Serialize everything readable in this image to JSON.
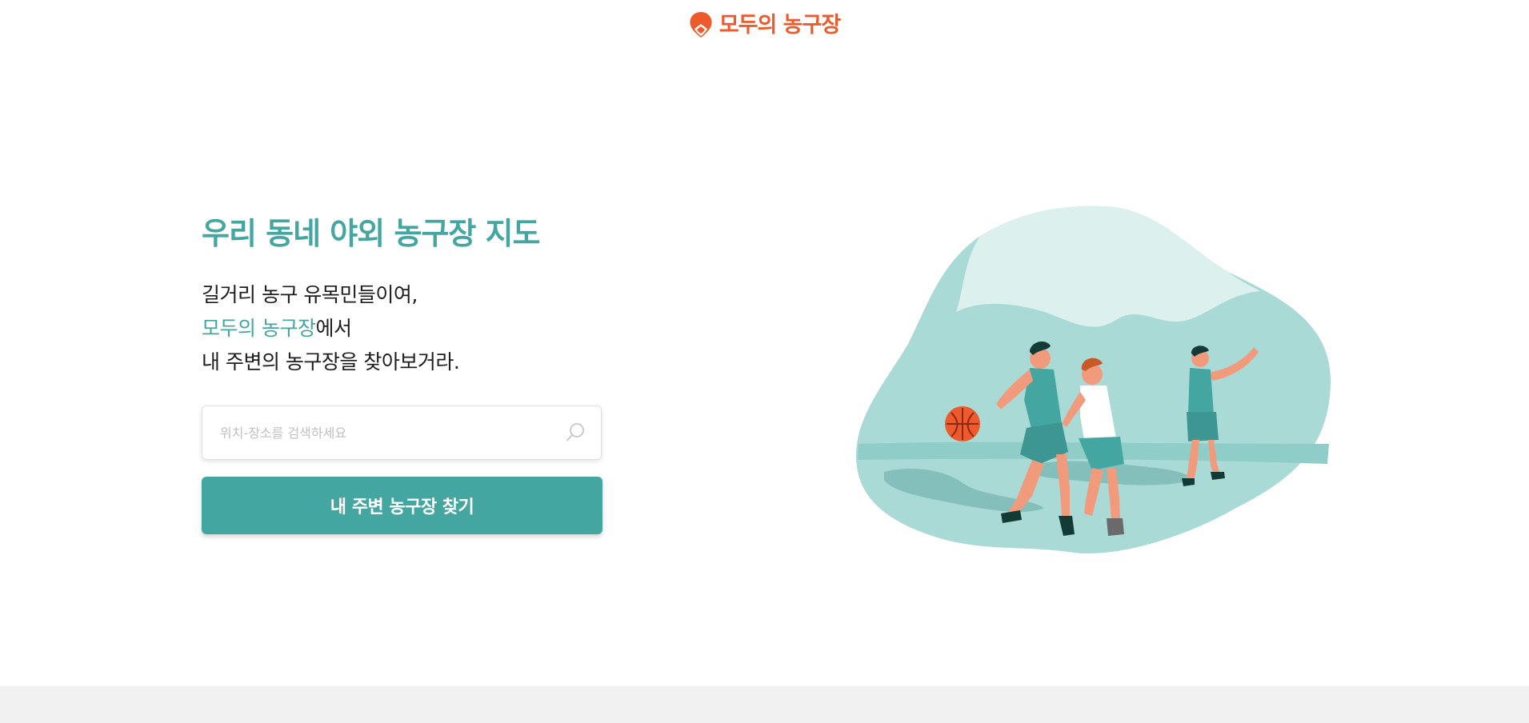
{
  "colors": {
    "brand_orange": "#ee5a2c",
    "accent_teal": "#44a6a1",
    "footer_gray": "#f1f1f1"
  },
  "header": {
    "logo_icon": "map-pin-icon",
    "logo_text": "모두의 농구장"
  },
  "hero": {
    "title": "우리 동네 야외 농구장 지도",
    "desc_line1": "길거리 농구 유목민들이여,",
    "desc_line2_highlight": "모두의 농구장",
    "desc_line2_rest": "에서",
    "desc_line3": "내 주변의 농구장을 찾아보거라."
  },
  "search": {
    "placeholder": "위치-장소를 검색하세요",
    "value": "",
    "icon": "search-icon"
  },
  "cta": {
    "label": "내 주변 농구장 찾기"
  },
  "illustration": {
    "icon": "basketball-players-illustration"
  }
}
